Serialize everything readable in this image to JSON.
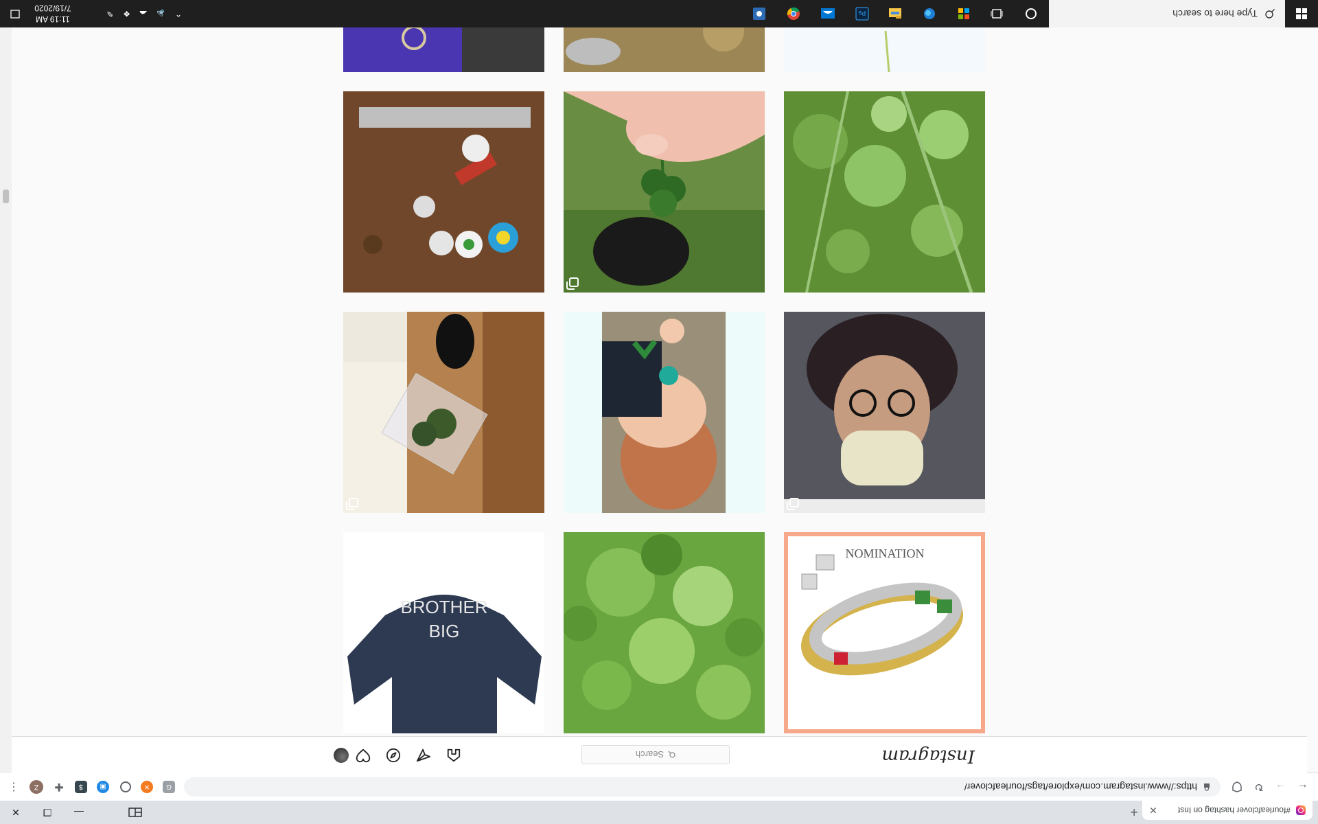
{
  "browser": {
    "tab_title": "#fourleafclover hashtag on Inst",
    "tab_close": "✕",
    "new_tab": "+",
    "window": {
      "minimize": "—",
      "restore": "❐",
      "close": "✕"
    },
    "url": "https://www.instagram.com/explore/tags/fourleafclover/",
    "profile_initial": "Z"
  },
  "instagram": {
    "logo": "Instagram",
    "search_placeholder": "Search"
  },
  "taskbar": {
    "search_placeholder": "Type here to search",
    "time": "11:19 AM",
    "date": "7/19/2020"
  }
}
